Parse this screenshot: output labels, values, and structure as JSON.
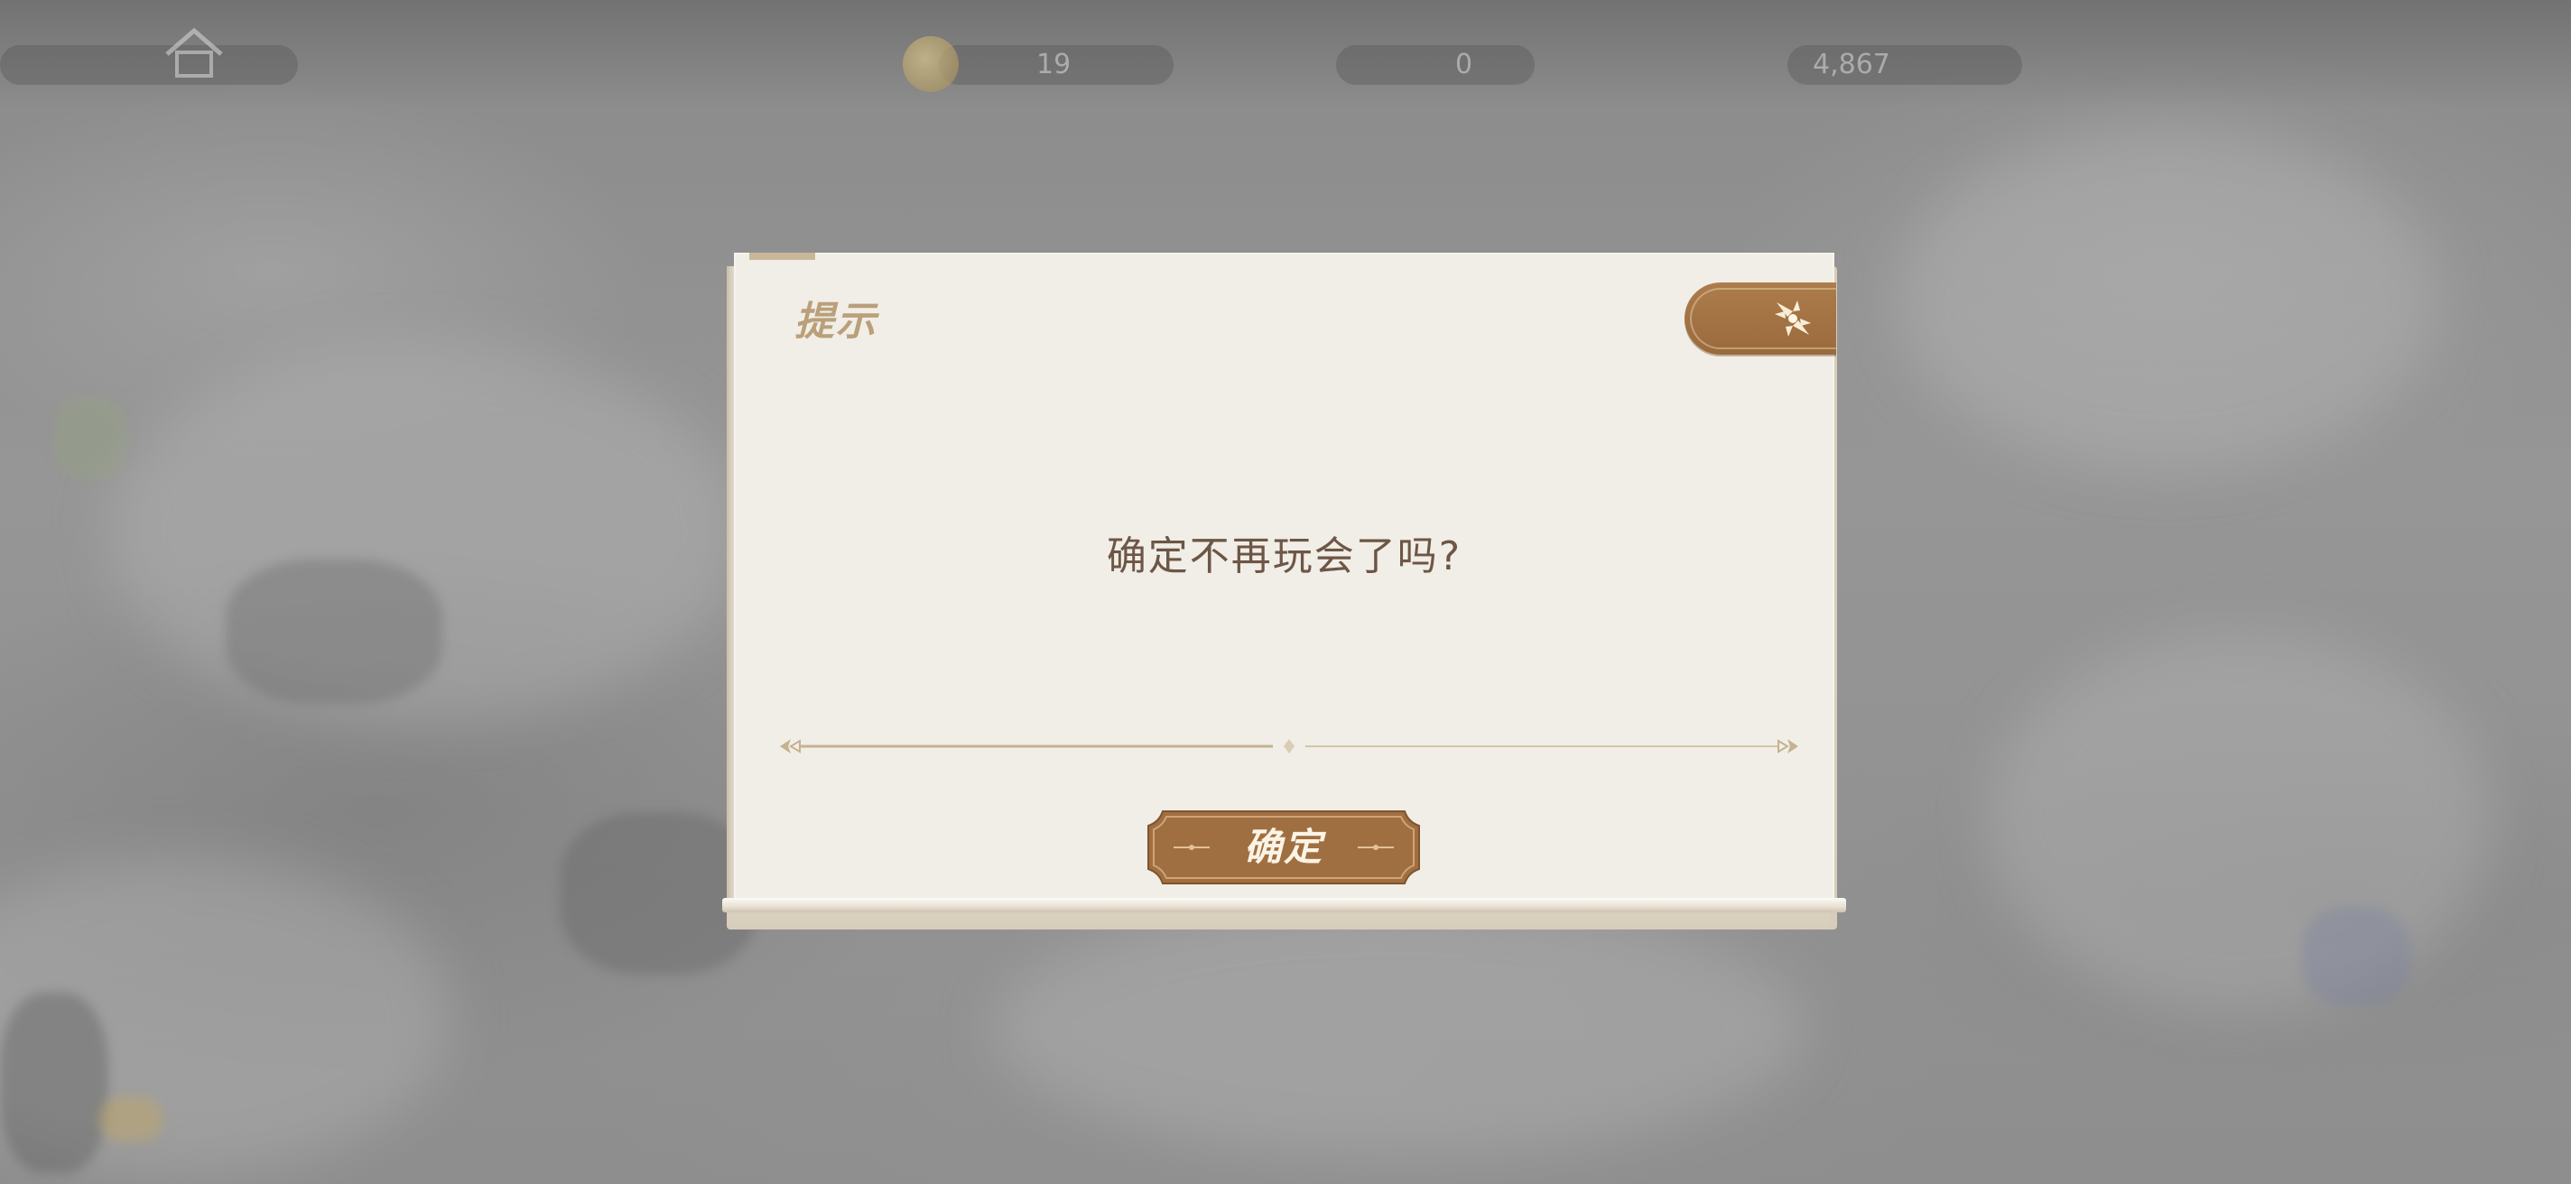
{
  "background": {
    "hud_values": [
      "19",
      "0",
      "4,867"
    ]
  },
  "dialog": {
    "title": "提示",
    "message": "确定不再玩会了吗?",
    "confirm_label": "确定",
    "close_icon": "close-x-icon",
    "colors": {
      "panel": "#f1eee7",
      "title": "#b9a07a",
      "message": "#6d5646",
      "button": "#a06f41",
      "button_text": "#fbf4e6"
    }
  }
}
